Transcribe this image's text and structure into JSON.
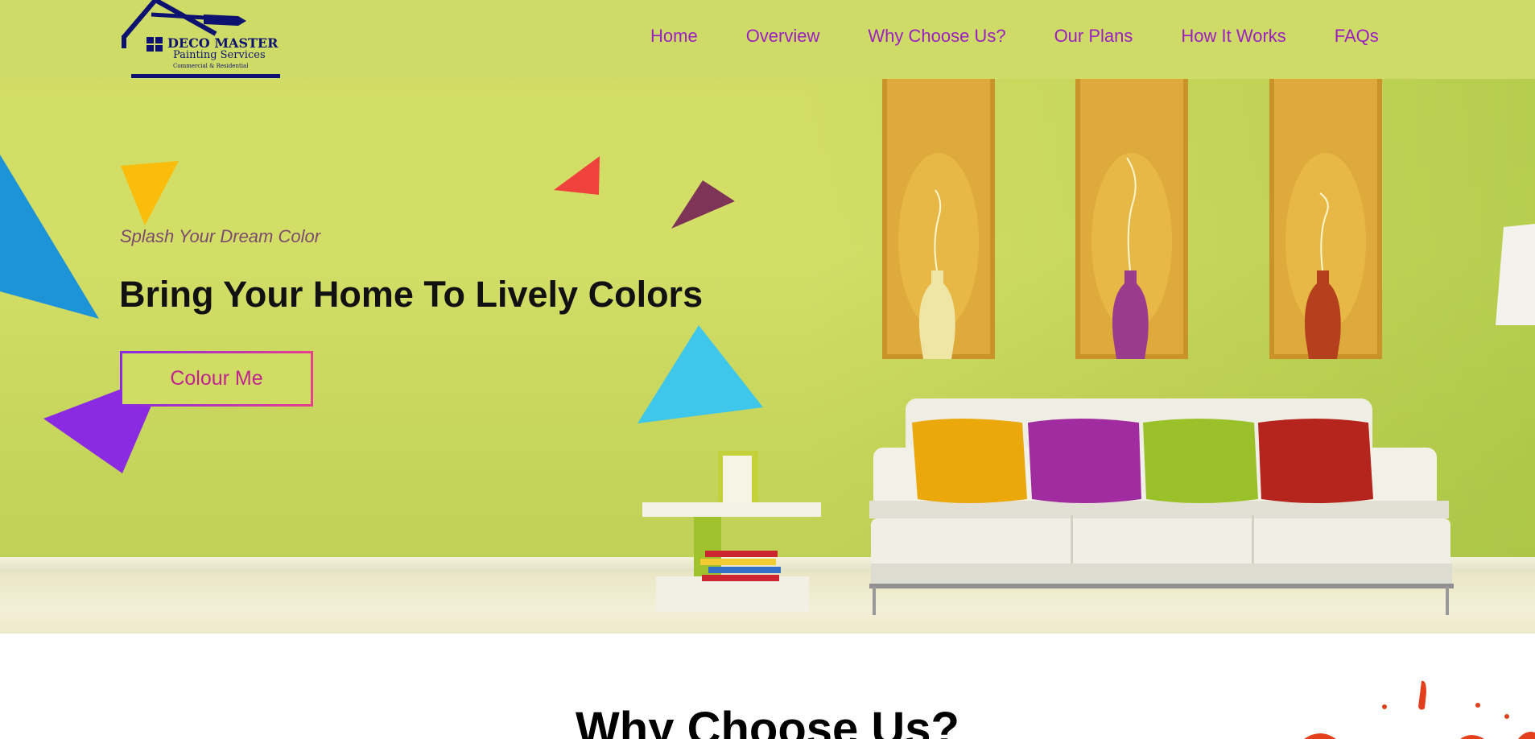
{
  "brand": {
    "name": "DECO MASTER",
    "subtitle": "Painting Services",
    "tagline": "Commercial & Residential",
    "color": "#0d1270"
  },
  "nav": {
    "color": "#9b1fc0",
    "items": [
      {
        "label": "Home"
      },
      {
        "label": "Overview"
      },
      {
        "label": "Why Choose Us?"
      },
      {
        "label": "Our Plans"
      },
      {
        "label": "How It Works"
      },
      {
        "label": "FAQs"
      }
    ]
  },
  "hero": {
    "tagline": "Splash Your Dream Color",
    "headline": "Bring Your Home To Lively Colors",
    "cta_label": "Colour Me",
    "background_color": "#d1dc64",
    "shape_colors": [
      "#fbbd0b",
      "#f0423d",
      "#7e3456",
      "#1d93d8",
      "#3ec6eb",
      "#8a2be2"
    ],
    "cushion_colors": [
      "#eaa80a",
      "#a12ca0",
      "#9bc12a",
      "#b6241e"
    ],
    "vase_colors": [
      "#efe6a6",
      "#9b3b8e",
      "#b4401e"
    ]
  },
  "section": {
    "title": "Why Choose Us?"
  }
}
